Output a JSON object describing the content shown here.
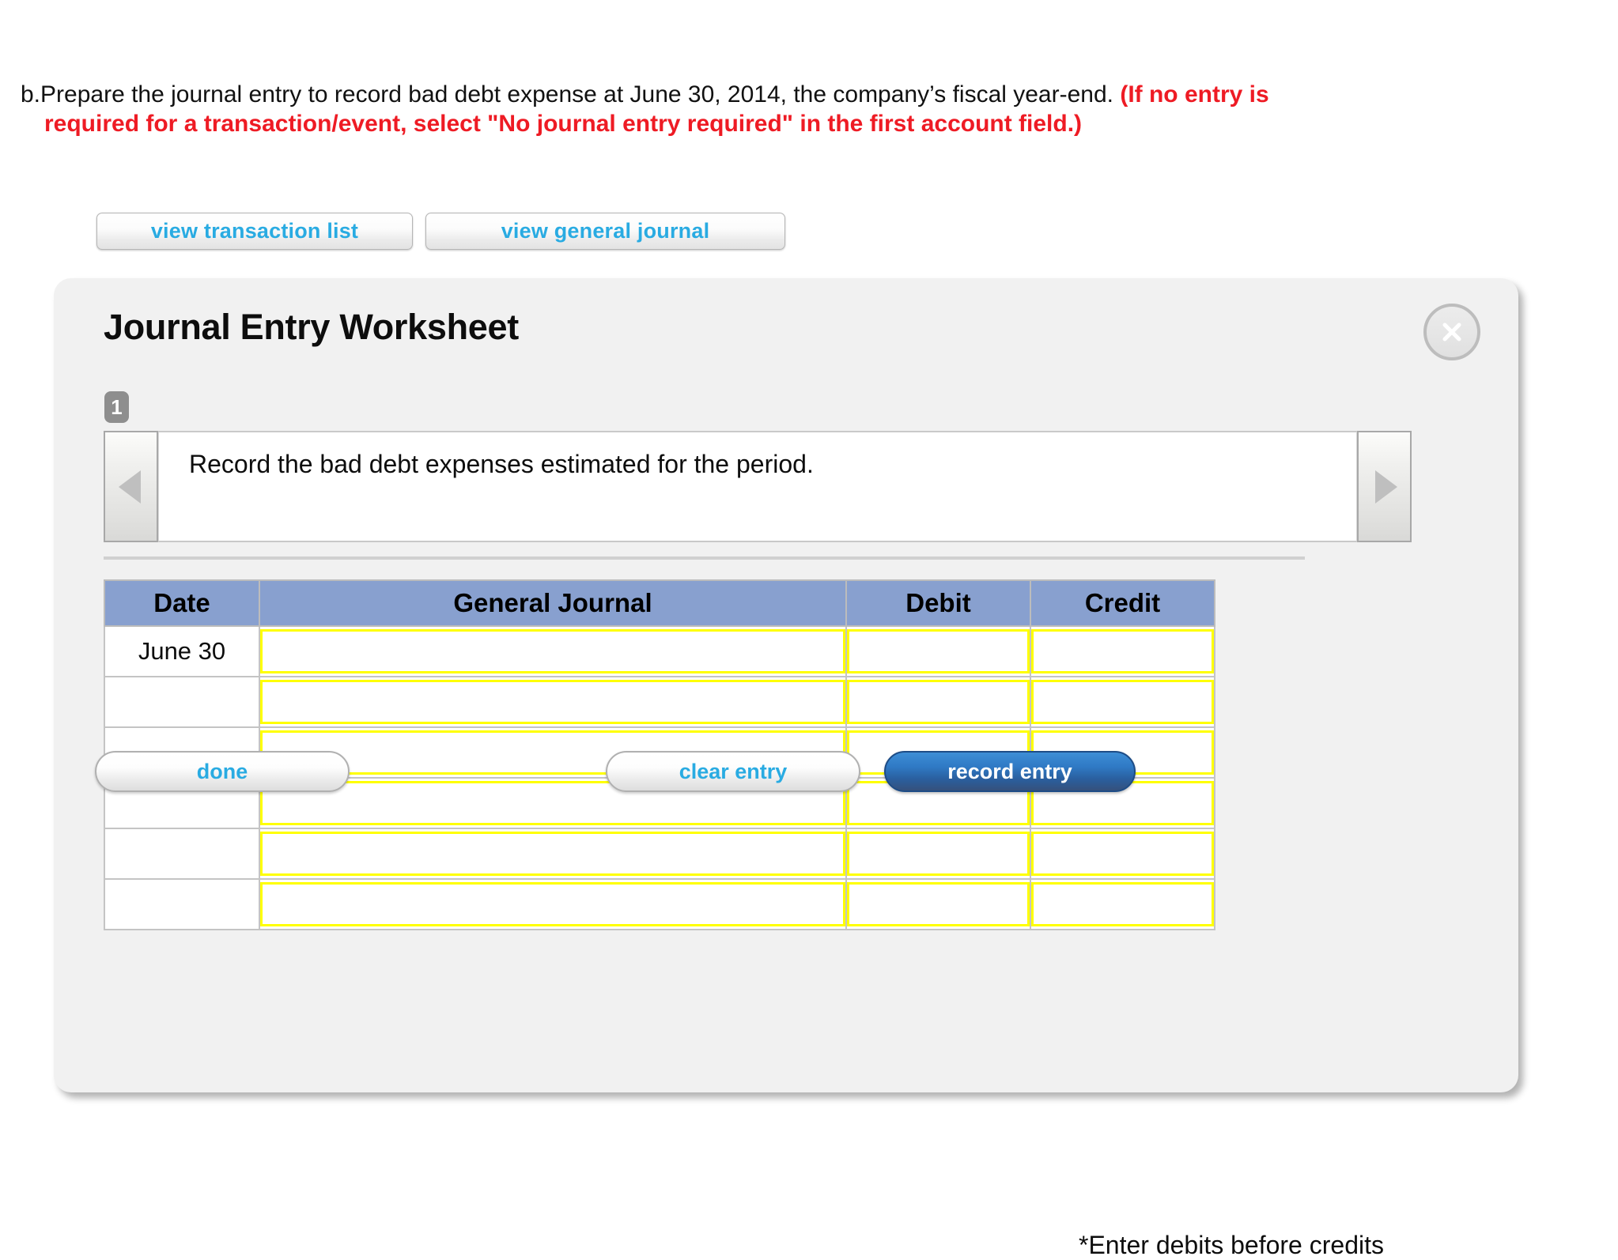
{
  "question": {
    "label": "b.",
    "text": "Prepare the journal entry to record bad debt expense at June 30, 2014, the company’s fiscal year-end. ",
    "hint_line1": "(If no entry is",
    "hint_line2": "required for a transaction/event, select \"No journal entry required\" in the first account field.)",
    "hint_color": "#ee1b24"
  },
  "top_buttons": {
    "transaction_list": "view transaction list",
    "general_journal": "view general journal"
  },
  "panel": {
    "title": "Journal Entry Worksheet",
    "close_icon": "close-x-icon",
    "step_number": "1",
    "description": "Record the bad debt expenses estimated for the period.",
    "prev_icon": "triangle-left-icon",
    "next_icon": "triangle-right-icon",
    "footnote": "*Enter debits before credits",
    "accent_blue": "#29abe2",
    "header_blue": "#88a0cf",
    "input_border_yellow": "#ffff00",
    "record_button_blue": "#2f79c4"
  },
  "table": {
    "headers": [
      "Date",
      "General Journal",
      "Debit",
      "Credit"
    ],
    "rows": [
      {
        "date": "June 30",
        "general_journal": "",
        "debit": "",
        "credit": ""
      },
      {
        "date": "",
        "general_journal": "",
        "debit": "",
        "credit": ""
      },
      {
        "date": "",
        "general_journal": "",
        "debit": "",
        "credit": ""
      },
      {
        "date": "",
        "general_journal": "",
        "debit": "",
        "credit": ""
      },
      {
        "date": "",
        "general_journal": "",
        "debit": "",
        "credit": ""
      },
      {
        "date": "",
        "general_journal": "",
        "debit": "",
        "credit": ""
      }
    ]
  },
  "actions": {
    "done": "done",
    "clear_entry": "clear entry",
    "record_entry": "record entry"
  }
}
